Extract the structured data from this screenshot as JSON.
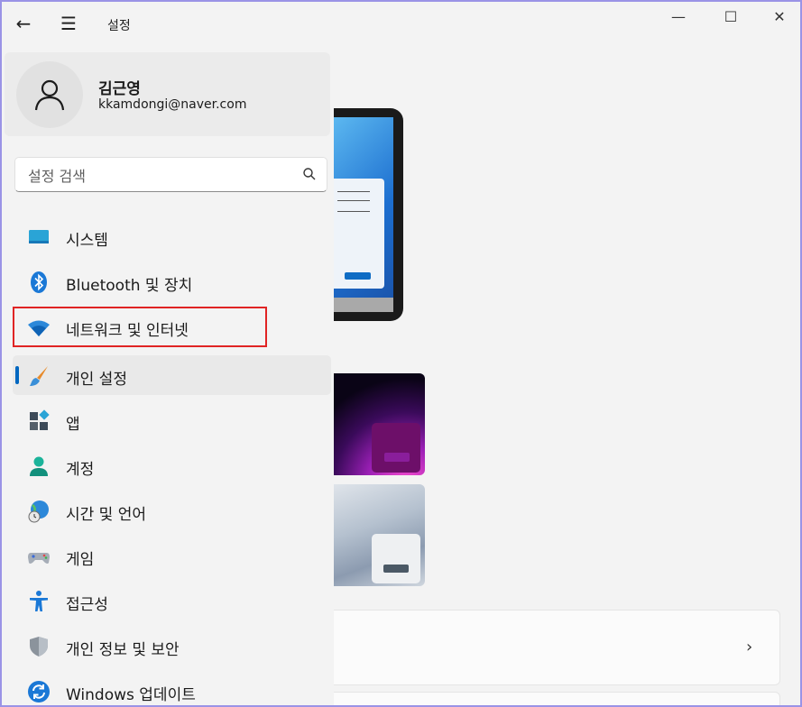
{
  "window": {
    "title": "설정",
    "controls": {
      "minimize": "—",
      "maximize": "☐",
      "close": "✕"
    }
  },
  "titlebar": {
    "back_icon": "←",
    "menu_icon": "☰"
  },
  "profile": {
    "name": "김근영",
    "email": "kkamdongi@naver.com"
  },
  "search": {
    "placeholder": "설정 검색"
  },
  "nav": {
    "items": [
      {
        "label": "시스템",
        "icon": "system-icon"
      },
      {
        "label": "Bluetooth 및 장치",
        "icon": "bluetooth-icon"
      },
      {
        "label": "네트워크 및 인터넷",
        "icon": "wifi-icon",
        "highlighted": true
      },
      {
        "label": "개인 설정",
        "icon": "brush-icon",
        "active": true
      },
      {
        "label": "앱",
        "icon": "apps-icon"
      },
      {
        "label": "계정",
        "icon": "account-icon"
      },
      {
        "label": "시간 및 언어",
        "icon": "globe-clock-icon"
      },
      {
        "label": "게임",
        "icon": "gamepad-icon"
      },
      {
        "label": "접근성",
        "icon": "accessibility-icon"
      },
      {
        "label": "개인 정보 및 보안",
        "icon": "shield-icon"
      },
      {
        "label": "Windows 업데이트",
        "icon": "update-icon"
      }
    ]
  },
  "content": {
    "card_chevron": "›"
  },
  "colors": {
    "accent": "#0067c0",
    "highlight_box": "#e02424",
    "window_border": "#9a93e6"
  }
}
